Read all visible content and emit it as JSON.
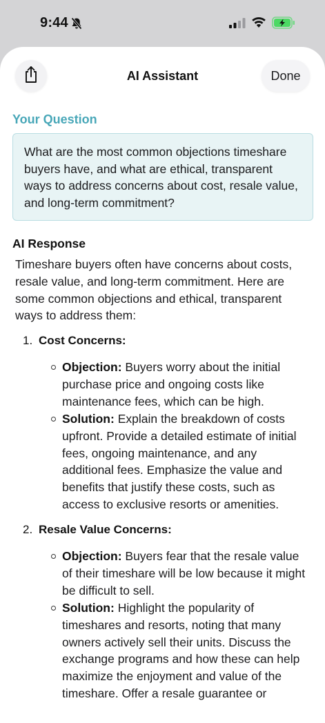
{
  "status_bar": {
    "time": "9:44"
  },
  "nav": {
    "title": "AI Assistant",
    "done_label": "Done"
  },
  "question": {
    "label": "Your Question",
    "text": "What are the most common objections timeshare buyers have, and what are ethical, transparent ways to address concerns about cost, resale value, and long-term commitment?"
  },
  "response": {
    "label": "AI Response",
    "intro": "Timeshare buyers often have concerns about costs, resale value, and long-term commitment. Here are some common objections and ethical, transparent ways to address them:",
    "sections": [
      {
        "number": "1.",
        "title": "Cost Concerns:",
        "objection_label": "Objection:",
        "objection": "Buyers worry about the initial purchase price and ongoing costs like maintenance fees, which can be high.",
        "solution_label": "Solution:",
        "solution": "Explain the breakdown of costs upfront. Provide a detailed estimate of initial fees, ongoing maintenance, and any additional fees. Emphasize the value and benefits that justify these costs, such as access to exclusive resorts or amenities."
      },
      {
        "number": "2.",
        "title": "Resale Value Concerns:",
        "objection_label": "Objection:",
        "objection": "Buyers fear that the resale value of their timeshare will be low because it might be difficult to sell.",
        "solution_label": "Solution:",
        "solution": "Highlight the popularity of timeshares and resorts, noting that many owners actively sell their units. Discuss the exchange programs and how these can help maximize the enjoyment and value of the timeshare. Offer a resale guarantee or"
      }
    ]
  },
  "colors": {
    "accent": "#48a7b8",
    "question_bg": "#e8f4f5",
    "question_border": "#b9dde2",
    "battery": "#4cd964"
  },
  "icons": [
    "bell-slash-icon",
    "cellular-signal-icon",
    "wifi-icon",
    "battery-charging-icon",
    "share-icon"
  ]
}
